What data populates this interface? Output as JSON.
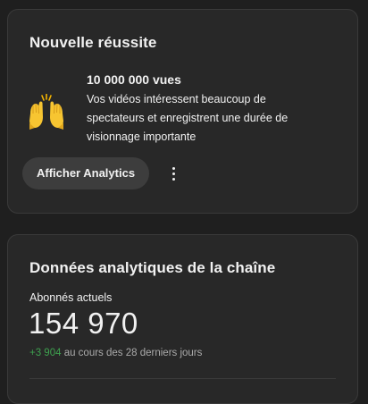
{
  "achievement_card": {
    "title": "Nouvelle réussite",
    "emoji_icon": "raising-hands-icon",
    "milestone_title": "10 000 000 vues",
    "milestone_description": "Vos vidéos intéressent beaucoup de spectateurs et enregistrent une durée de visionnage importante",
    "button_label": "Afficher Analytics",
    "more_icon": "more-vert-icon"
  },
  "analytics_card": {
    "title": "Données analytiques de la chaîne",
    "subscribers_label": "Abonnés actuels",
    "subscribers_count": "154 970",
    "delta_value": "+3 904",
    "delta_text": " au cours des 28 derniers jours"
  },
  "colors": {
    "background": "#1f1f1f",
    "card": "#282828",
    "positive": "#3ea14f"
  }
}
